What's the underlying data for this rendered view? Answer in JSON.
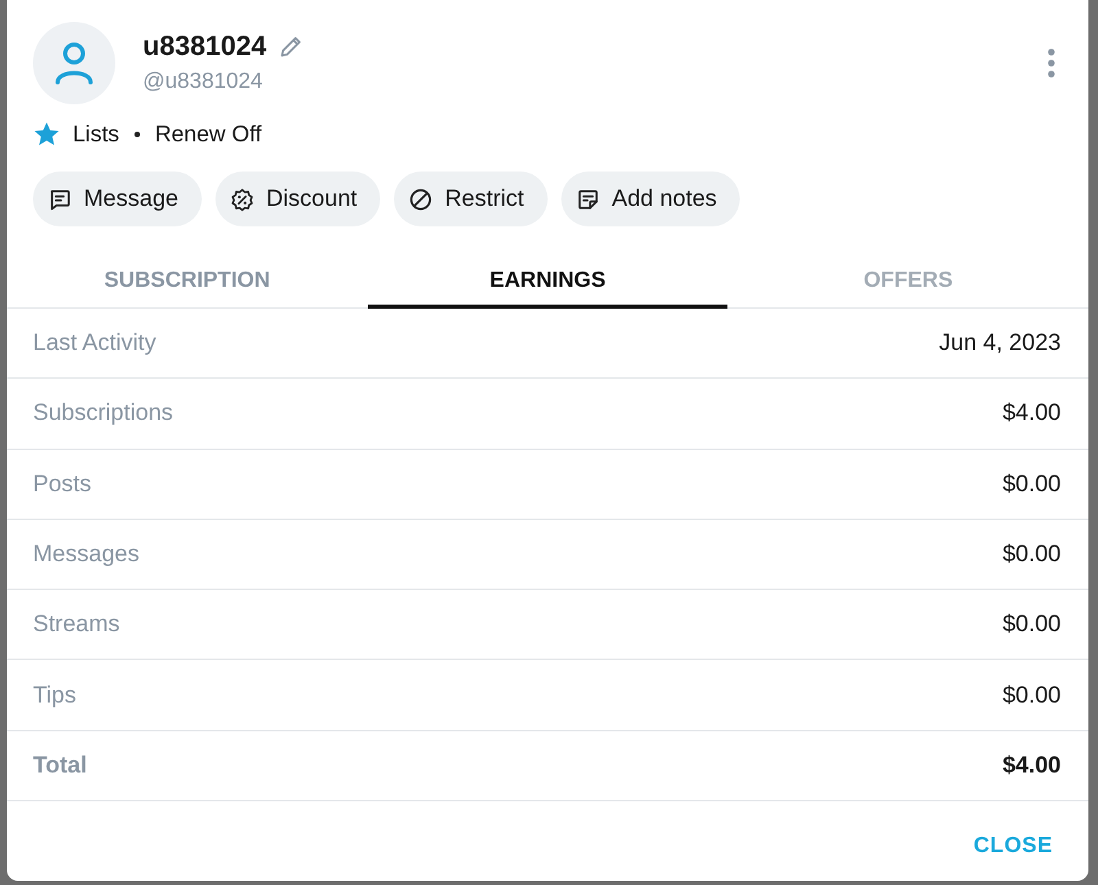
{
  "profile": {
    "name": "u8381024",
    "handle": "@u8381024",
    "lists": "Lists",
    "renew": "Renew Off"
  },
  "actions": [
    {
      "label": "Message",
      "kind": "message"
    },
    {
      "label": "Discount",
      "kind": "discount"
    },
    {
      "label": "Restrict",
      "kind": "restrict"
    },
    {
      "label": "Add notes",
      "kind": "notes"
    }
  ],
  "tabs": [
    {
      "label": "SUBSCRIPTION",
      "selected": false,
      "disabled": false
    },
    {
      "label": "EARNINGS",
      "selected": true,
      "disabled": false
    },
    {
      "label": "OFFERS",
      "selected": false,
      "disabled": true
    }
  ],
  "rows": [
    {
      "label": "Last Activity",
      "value": "Jun 4, 2023",
      "kind": "item"
    },
    {
      "label": "Subscriptions",
      "value": "$4.00",
      "kind": "item"
    },
    {
      "label": "Posts",
      "value": "$0.00",
      "kind": "item"
    },
    {
      "label": "Messages",
      "value": "$0.00",
      "kind": "item"
    },
    {
      "label": "Streams",
      "value": "$0.00",
      "kind": "item"
    },
    {
      "label": "Tips",
      "value": "$0.00",
      "kind": "item"
    },
    {
      "label": "Total",
      "value": "$4.00",
      "kind": "total"
    }
  ],
  "footer": {
    "close": "CLOSE"
  }
}
